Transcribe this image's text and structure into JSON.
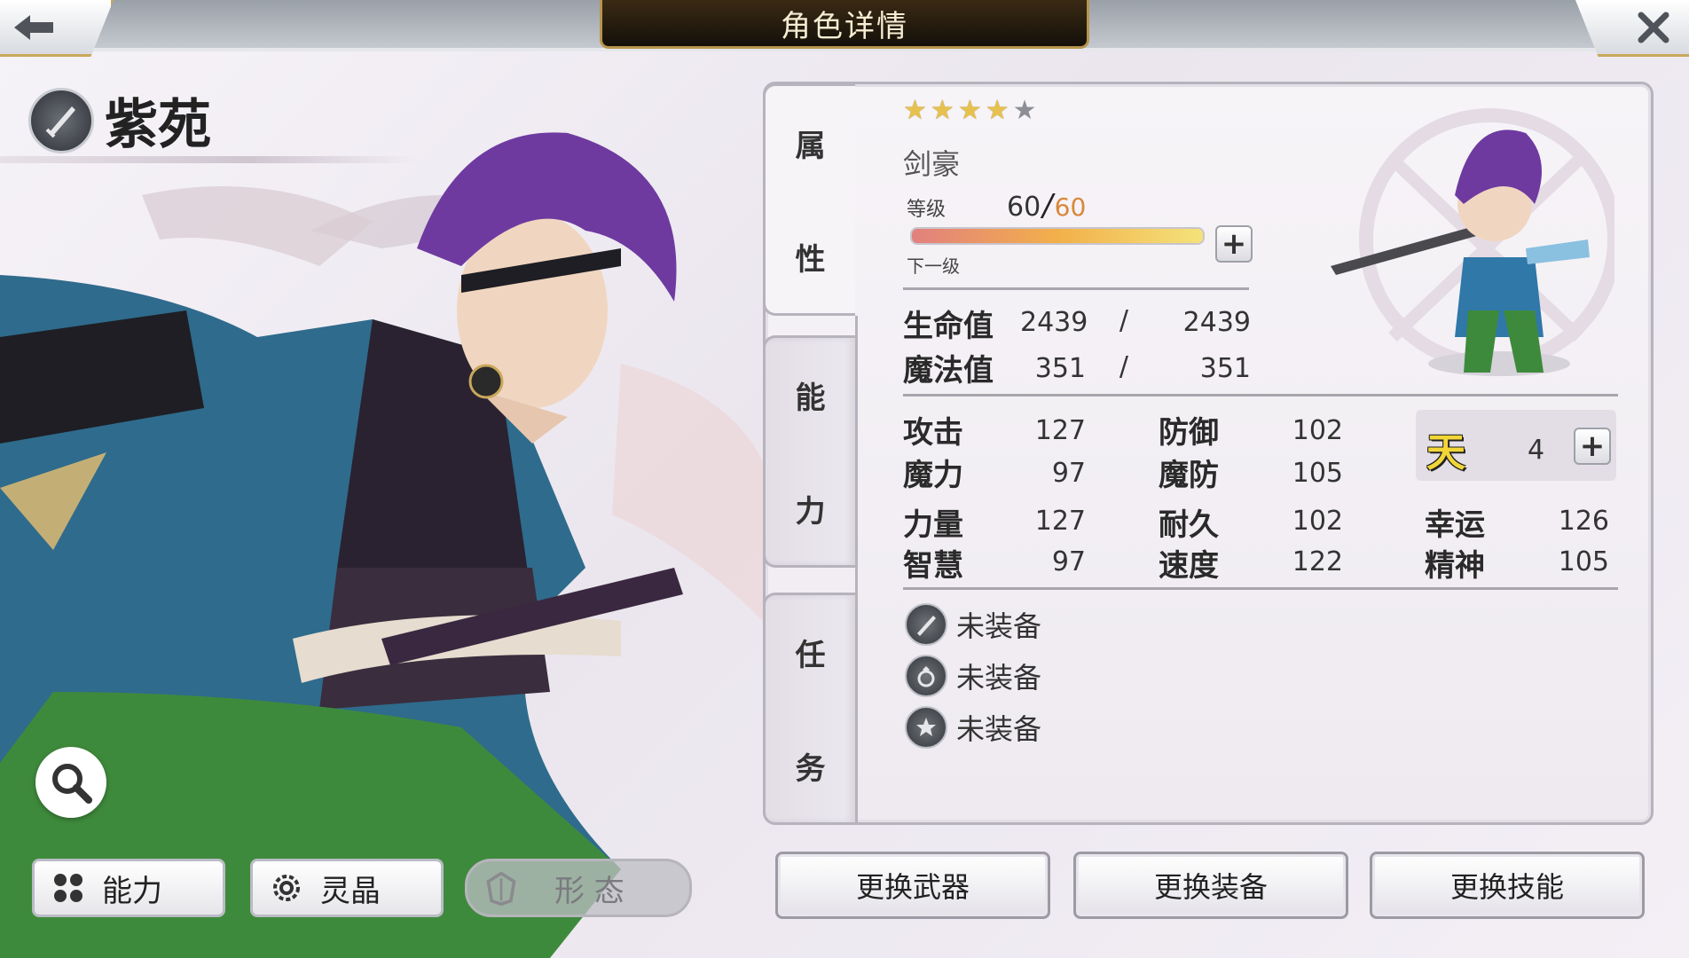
{
  "header": {
    "title": "角色详情"
  },
  "character": {
    "name": "紫苑",
    "job": "剑豪",
    "stars_on": 4,
    "stars_total": 5
  },
  "level": {
    "label": "等级",
    "current": "60",
    "max": "60",
    "next_label": "下一级",
    "xp_fraction": 1.0
  },
  "tabs": {
    "attributes": [
      "属",
      "性"
    ],
    "ability": [
      "能",
      "力"
    ],
    "mission": [
      "任",
      "务"
    ]
  },
  "vitals": [
    {
      "label": "生命值",
      "current": "2439",
      "sep": "/",
      "max": "2439"
    },
    {
      "label": "魔法值",
      "current": "351",
      "sep": "/",
      "max": "351"
    }
  ],
  "stats": {
    "atk": {
      "label": "攻击",
      "value": "127"
    },
    "mag": {
      "label": "魔力",
      "value": "97"
    },
    "def": {
      "label": "防御",
      "value": "102"
    },
    "mdef": {
      "label": "魔防",
      "value": "105"
    },
    "str": {
      "label": "力量",
      "value": "127"
    },
    "int": {
      "label": "智慧",
      "value": "97"
    },
    "end": {
      "label": "耐久",
      "value": "102"
    },
    "spd": {
      "label": "速度",
      "value": "122"
    },
    "luck": {
      "label": "幸运",
      "value": "126"
    },
    "spirit": {
      "label": "精神",
      "value": "105"
    }
  },
  "heaven": {
    "glyph": "天",
    "value": "4"
  },
  "equipment": [
    {
      "icon": "sword-icon",
      "label": "未装备"
    },
    {
      "icon": "ring-icon",
      "label": "未装备"
    },
    {
      "icon": "star-emblem-icon",
      "label": "未装备"
    }
  ],
  "mode_buttons": {
    "ability": "能力",
    "crystal": "灵晶",
    "form": "形 态"
  },
  "actions": {
    "weapon": "更换武器",
    "gear": "更换装备",
    "skill": "更换技能"
  },
  "colors": {
    "accent_gold": "#c8a85a",
    "xp_end": "#f5e27a",
    "xp_start": "#e2807e",
    "star": "#e7c14e"
  }
}
